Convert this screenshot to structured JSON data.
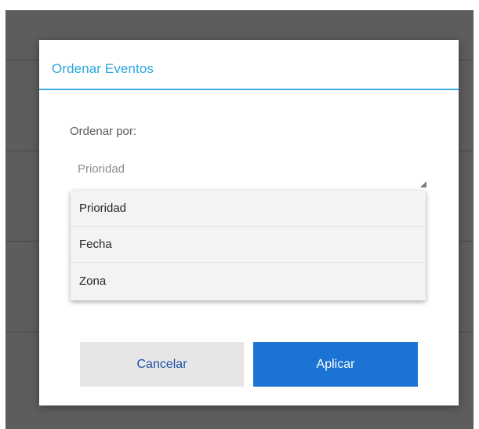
{
  "dialog": {
    "title": "Ordenar Eventos",
    "sort_label": "Ordenar por:",
    "selected_value": "Prioridad",
    "options": [
      "Prioridad",
      "Fecha",
      "Zona"
    ],
    "cancel_label": "Cancelar",
    "apply_label": "Aplicar"
  },
  "colors": {
    "accent": "#2aa8df",
    "primary_button": "#1b73d3",
    "secondary_button": "#e6e6e6",
    "backdrop": "#5d5d5d"
  }
}
